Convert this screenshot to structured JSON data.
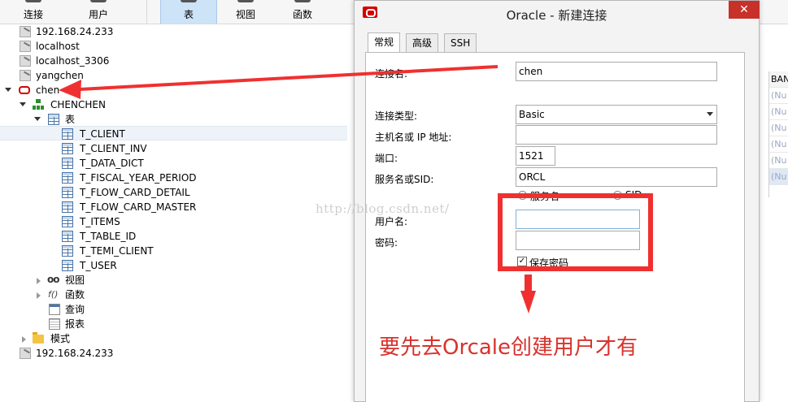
{
  "toolbar": {
    "items": [
      {
        "label": "连接",
        "icon": "connect-icon"
      },
      {
        "label": "用户",
        "icon": "user-icon"
      },
      {
        "label": "表",
        "icon": "table-icon"
      },
      {
        "label": "视图",
        "icon": "view-icon"
      },
      {
        "label": "函数",
        "icon": "function-icon"
      }
    ],
    "active": "表"
  },
  "tree": {
    "connections_top": [
      "192.168.24.233",
      "localhost",
      "localhost_3306",
      "yangchen"
    ],
    "oracle_connection": "chen",
    "schema": "CHENCHEN",
    "tables_group": "表",
    "tables": [
      "T_CLIENT",
      "T_CLIENT_INV",
      "T_DATA_DICT",
      "T_FISCAL_YEAR_PERIOD",
      "T_FLOW_CARD_DETAIL",
      "T_FLOW_CARD_MASTER",
      "T_ITEMS",
      "T_TABLE_ID",
      "T_TEMI_CLIENT",
      "T_USER"
    ],
    "selected_table": "T_CLIENT",
    "other_groups": [
      "视图",
      "函数",
      "查询",
      "报表"
    ],
    "schemas_group": "模式",
    "connection_bottom": "192.168.24.233"
  },
  "grid": {
    "header": "BAN",
    "cells": [
      "(Nu",
      "(Nu",
      "(Nu",
      "(Nu",
      "(Nu",
      "(Nu"
    ]
  },
  "dialog": {
    "title": "Oracle - 新建连接",
    "close_glyph": "✕",
    "tabs": [
      "常规",
      "高级",
      "SSH"
    ],
    "fields": {
      "connection_name_label": "连接名:",
      "connection_name_value": "chen",
      "connection_type_label": "连接类型:",
      "connection_type_value": "Basic",
      "host_label": "主机名或 IP 地址:",
      "host_value": "",
      "port_label": "端口:",
      "port_value": "1521",
      "service_label": "服务名或SID:",
      "service_value": "ORCL",
      "radio_service_name": "服务名",
      "radio_sid": "SID",
      "username_label": "用户名:",
      "username_value": "",
      "password_label": "密码:",
      "password_value": "",
      "save_password_label": "保存密码",
      "save_password_checked": true
    }
  },
  "annotation": {
    "text": "要先去Orcale创建用户才有",
    "watermark": "http://blog.csdn.net/",
    "color": "#f03030"
  }
}
